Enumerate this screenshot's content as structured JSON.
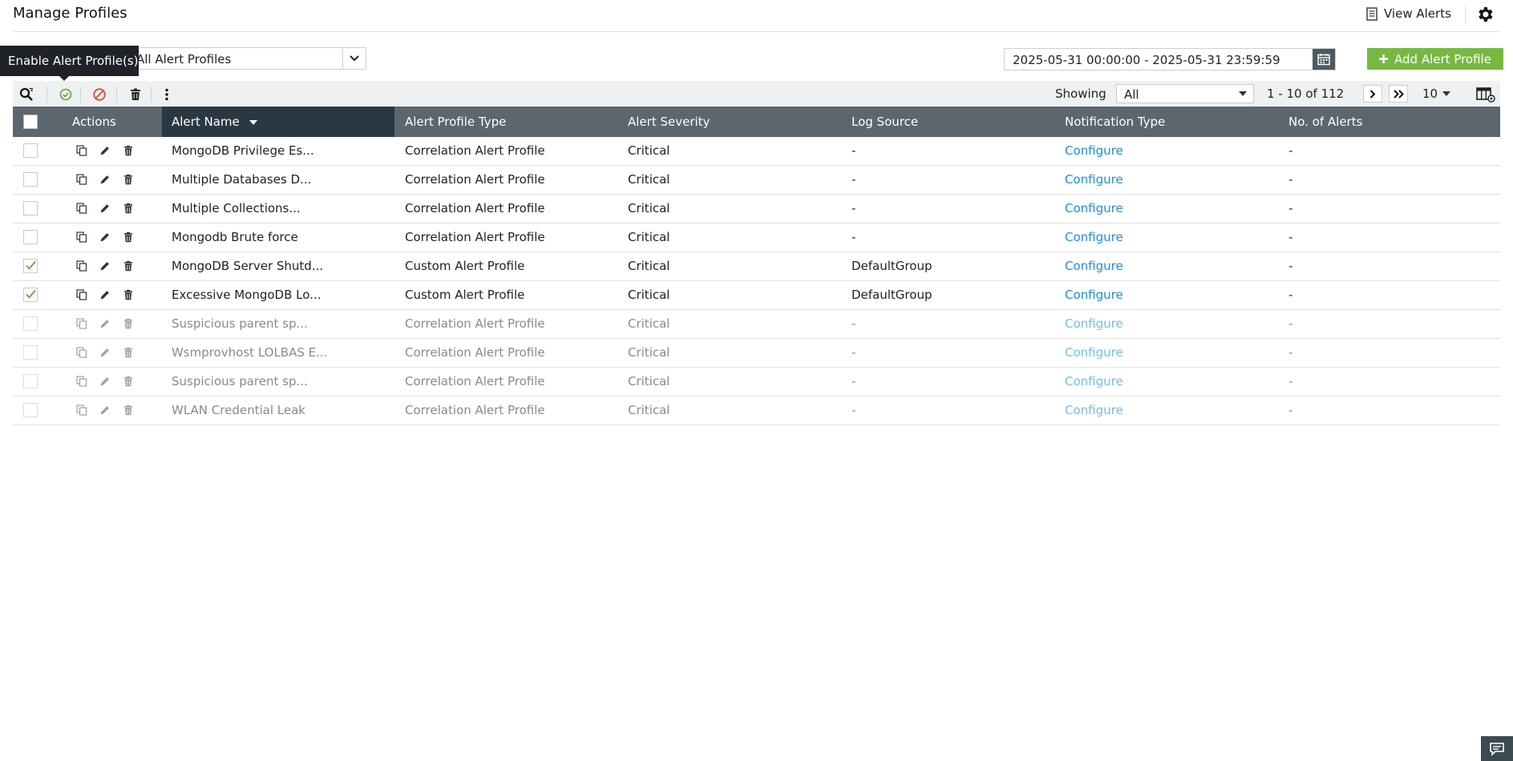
{
  "header": {
    "title": "Manage Profiles",
    "view_alerts": "View Alerts"
  },
  "filter": {
    "selected": "All Alert Profiles",
    "tooltip": "Enable Alert Profile(s)"
  },
  "date_range": "2025-05-31 00:00:00 - 2025-05-31 23:59:59",
  "add_button": "Add Alert Profile",
  "toolbar": {
    "showing_label": "Showing",
    "showing_value": "All",
    "range": "1 - 10 of 112",
    "per_page": "10"
  },
  "table": {
    "columns": {
      "actions": "Actions",
      "alert_name": "Alert Name",
      "profile_type": "Alert Profile Type",
      "severity": "Alert Severity",
      "log_source": "Log Source",
      "notification": "Notification Type",
      "count": "No. of Alerts"
    },
    "rows": [
      {
        "name": "MongoDB Privilege Es...",
        "type": "Correlation Alert Profile",
        "severity": "Critical",
        "log_source": "-",
        "notification": "Configure",
        "count": "-",
        "checked": false,
        "enabled": true
      },
      {
        "name": "Multiple Databases D...",
        "type": "Correlation Alert Profile",
        "severity": "Critical",
        "log_source": "-",
        "notification": "Configure",
        "count": "-",
        "checked": false,
        "enabled": true
      },
      {
        "name": "Multiple Collections...",
        "type": "Correlation Alert Profile",
        "severity": "Critical",
        "log_source": "-",
        "notification": "Configure",
        "count": "-",
        "checked": false,
        "enabled": true
      },
      {
        "name": "Mongodb Brute force",
        "type": "Correlation Alert Profile",
        "severity": "Critical",
        "log_source": "-",
        "notification": "Configure",
        "count": "-",
        "checked": false,
        "enabled": true
      },
      {
        "name": "MongoDB Server Shutd...",
        "type": "Custom Alert Profile",
        "severity": "Critical",
        "log_source": "DefaultGroup",
        "notification": "Configure",
        "count": "-",
        "checked": true,
        "enabled": true
      },
      {
        "name": "Excessive MongoDB Lo...",
        "type": "Custom Alert Profile",
        "severity": "Critical",
        "log_source": "DefaultGroup",
        "notification": "Configure",
        "count": "-",
        "checked": true,
        "enabled": true
      },
      {
        "name": "Suspicious parent sp...",
        "type": "Correlation Alert Profile",
        "severity": "Critical",
        "log_source": "-",
        "notification": "Configure",
        "count": "-",
        "checked": false,
        "enabled": false
      },
      {
        "name": "Wsmprovhost LOLBAS E...",
        "type": "Correlation Alert Profile",
        "severity": "Critical",
        "log_source": "-",
        "notification": "Configure",
        "count": "-",
        "checked": false,
        "enabled": false
      },
      {
        "name": "Suspicious parent sp...",
        "type": "Correlation Alert Profile",
        "severity": "Critical",
        "log_source": "-",
        "notification": "Configure",
        "count": "-",
        "checked": false,
        "enabled": false
      },
      {
        "name": "WLAN Credential Leak",
        "type": "Correlation Alert Profile",
        "severity": "Critical",
        "log_source": "-",
        "notification": "Configure",
        "count": "-",
        "checked": false,
        "enabled": false
      }
    ]
  },
  "colors": {
    "accent_green": "#77b843",
    "header_bg": "#5b666e",
    "sorted_header_bg": "#2b3842",
    "link_blue": "#1f8ed1"
  }
}
